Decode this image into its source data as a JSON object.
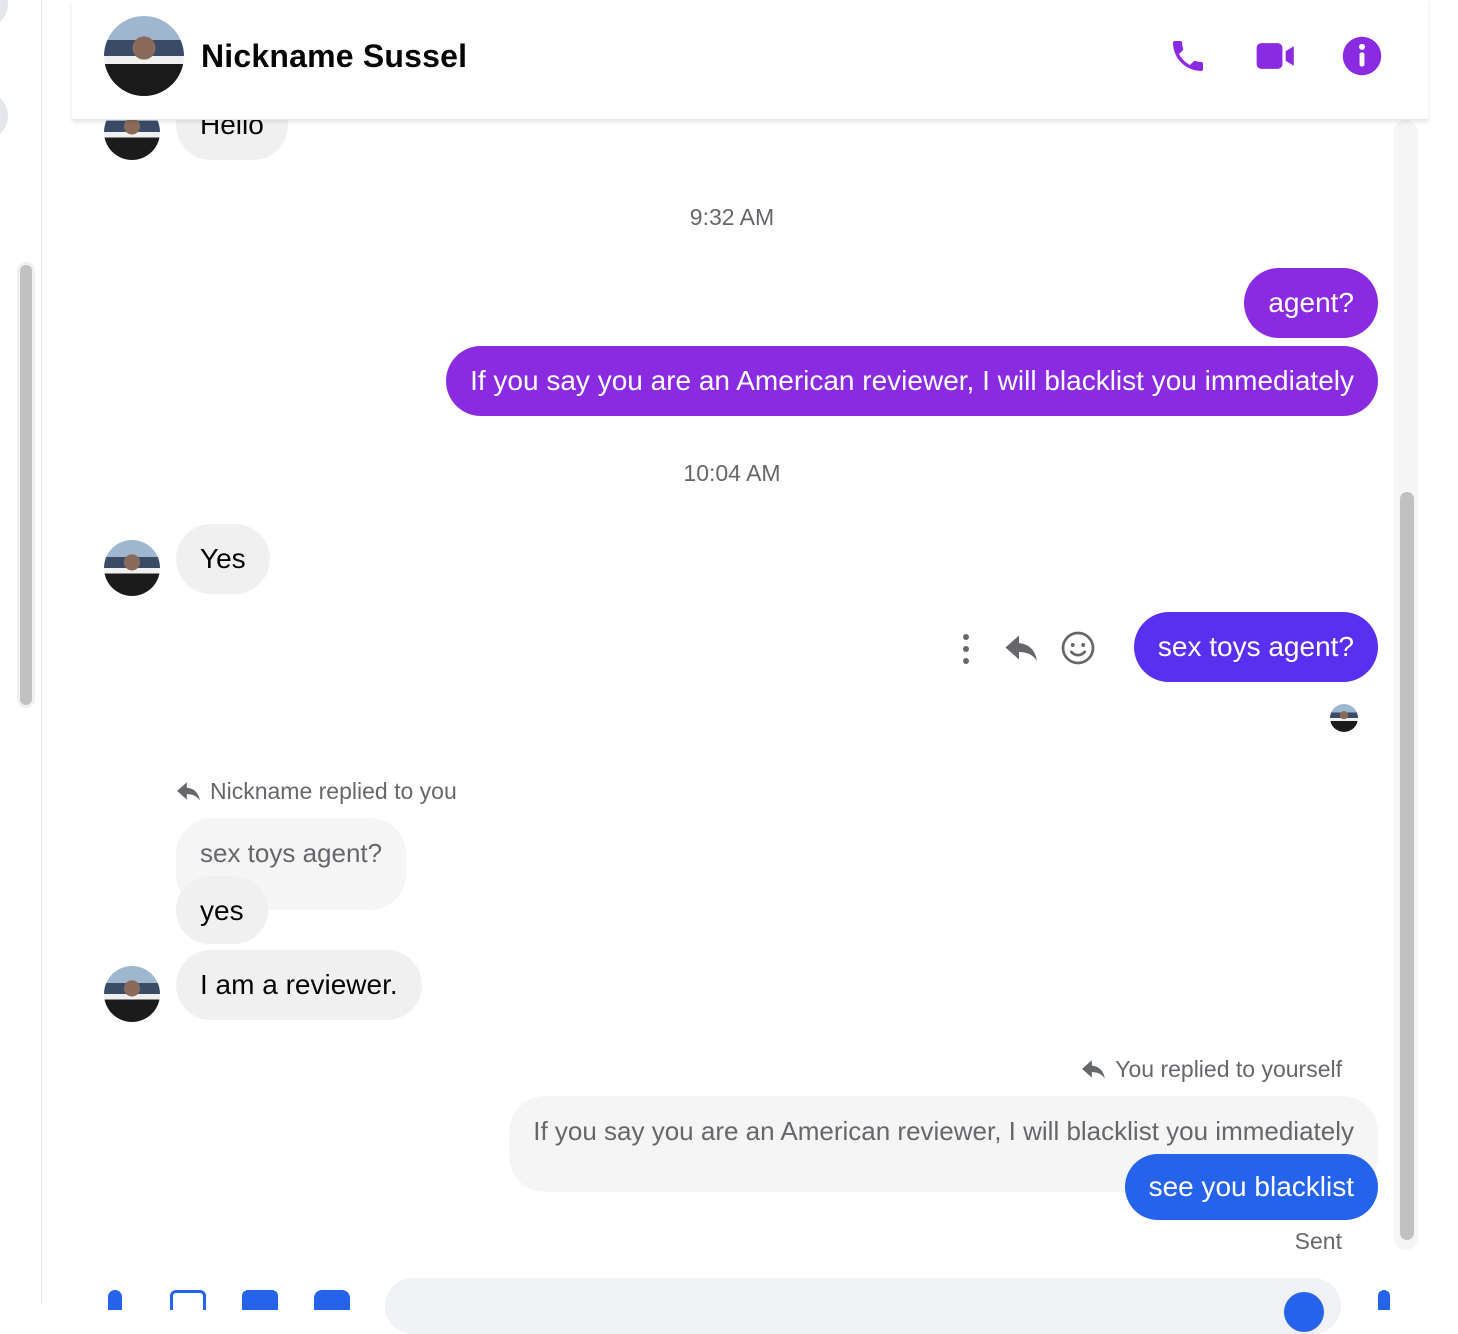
{
  "header": {
    "contact_name": "Nickname Sussel",
    "phone_label": "phone-icon",
    "video_label": "video-icon",
    "info_label": "info-icon"
  },
  "accent_color": "#8a2be2",
  "messages": {
    "m0": "Hello",
    "ts1": "9:32 AM",
    "m1": "agent?",
    "m2": "If you say you are an American reviewer, I will blacklist you immediately",
    "ts2": "10:04 AM",
    "m3": "Yes",
    "m4": "sex toys agent?",
    "reply1_meta": "Nickname replied to you",
    "reply1_quote": "sex toys agent?",
    "m5": "yes",
    "m6": "I am a reviewer.",
    "reply2_meta": "You replied to yourself",
    "reply2_quote": "If you say you are an American reviewer, I will blacklist you immediately",
    "m7": "see you blacklist",
    "status": "Sent"
  }
}
